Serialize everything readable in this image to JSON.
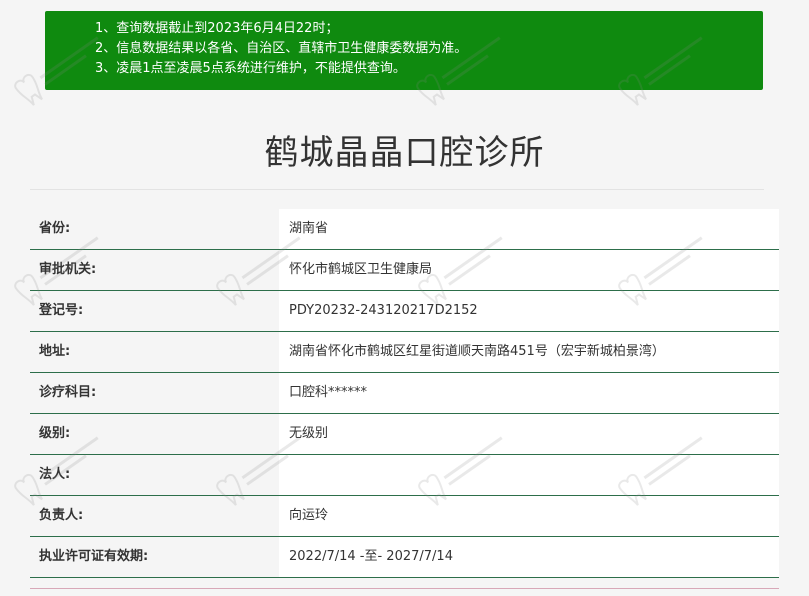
{
  "notice": {
    "lines": [
      "1、查询数据截止到2023年6月4日22时；",
      "2、信息数据结果以各省、自治区、直辖市卫生健康委数据为准。",
      "3、凌晨1点至凌晨5点系统进行维护，不能提供查询。"
    ],
    "background": "#0f8a0f"
  },
  "title": "鹤城晶晶口腔诊所",
  "rows": [
    {
      "label": "省份:",
      "value": "湖南省"
    },
    {
      "label": "审批机关:",
      "value": "怀化市鹤城区卫生健康局"
    },
    {
      "label": "登记号:",
      "value": "PDY20232-243120217D2152"
    },
    {
      "label": "地址:",
      "value": "湖南省怀化市鹤城区红星街道顺天南路451号（宏宇新城柏景湾）"
    },
    {
      "label": "诊疗科目:",
      "value": "口腔科******"
    },
    {
      "label": "级别:",
      "value": "无级别"
    },
    {
      "label": "法人:",
      "value": ""
    },
    {
      "label": "负责人:",
      "value": "向运玲"
    },
    {
      "label": "执业许可证有效期:",
      "value": "2022/7/14 -至- 2027/7/14"
    }
  ],
  "colors": {
    "row_border": "#2d6e4a",
    "label_bg": "#f5f5f5",
    "value_bg": "#ffffff"
  },
  "watermark_icon": "tooth-logo-icon"
}
